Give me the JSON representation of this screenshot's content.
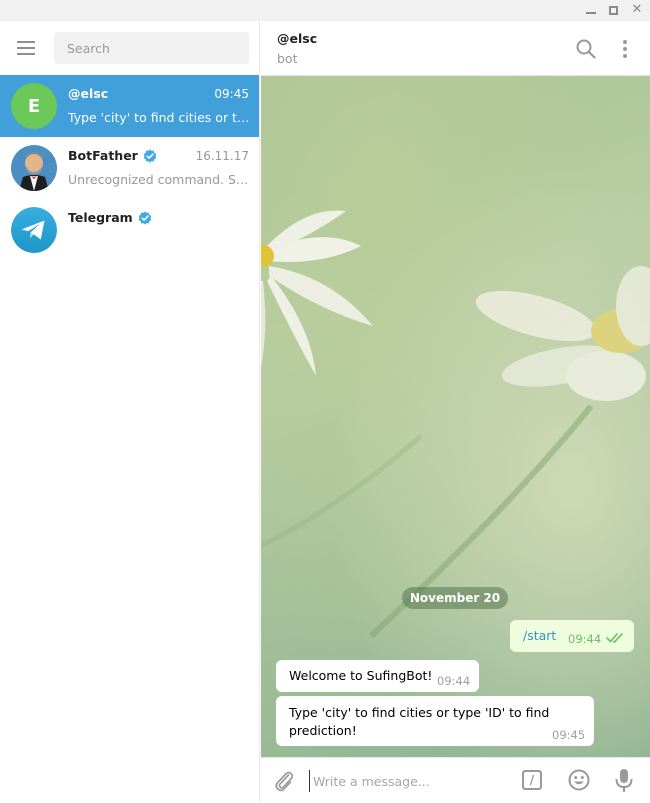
{
  "window": {
    "minimize_icon": "minimize-icon",
    "maximize_icon": "maximize-icon",
    "close_glyph": "✕"
  },
  "sidebar": {
    "menu_icon": "hamburger-menu-icon",
    "search": {
      "placeholder": "Search",
      "value": ""
    },
    "chats": [
      {
        "name": "@elsc",
        "time": "09:45",
        "preview": "Type 'city' to find cities or type 'ID' to find prediction!",
        "avatar_letter": "E",
        "avatar_color": "#6bc858",
        "active": true,
        "verified": false
      },
      {
        "name": "BotFather",
        "time": "16.11.17",
        "preview": "Unrecognized command. Say what?",
        "avatar": "botfather-avatar",
        "active": false,
        "verified": true
      },
      {
        "name": "Telegram",
        "time": "",
        "preview": "",
        "avatar": "telegram-logo-avatar",
        "active": false,
        "verified": true
      }
    ]
  },
  "header": {
    "title": "@elsc",
    "status": "bot",
    "search_icon": "search-icon",
    "more_icon": "more-vertical-icon"
  },
  "conversation": {
    "date_label": "November 20",
    "messages": [
      {
        "direction": "out",
        "text": "/start",
        "time": "09:44",
        "read": true
      },
      {
        "direction": "in",
        "text": "Welcome to SufingBot!",
        "time": "09:44"
      },
      {
        "direction": "in",
        "text": "Type 'city' to find cities or type 'ID' to find prediction!",
        "time": "09:45"
      }
    ]
  },
  "composer": {
    "placeholder": "Write a message...",
    "value": "",
    "attach_icon": "paperclip-icon",
    "command_glyph": "/",
    "emoji_icon": "emoji-icon",
    "mic_icon": "microphone-icon"
  },
  "colors": {
    "accent": "#419fd9",
    "outgoing_bubble": "#effdde",
    "incoming_bubble": "#ffffff",
    "read_ticks": "#6cbf5f"
  }
}
